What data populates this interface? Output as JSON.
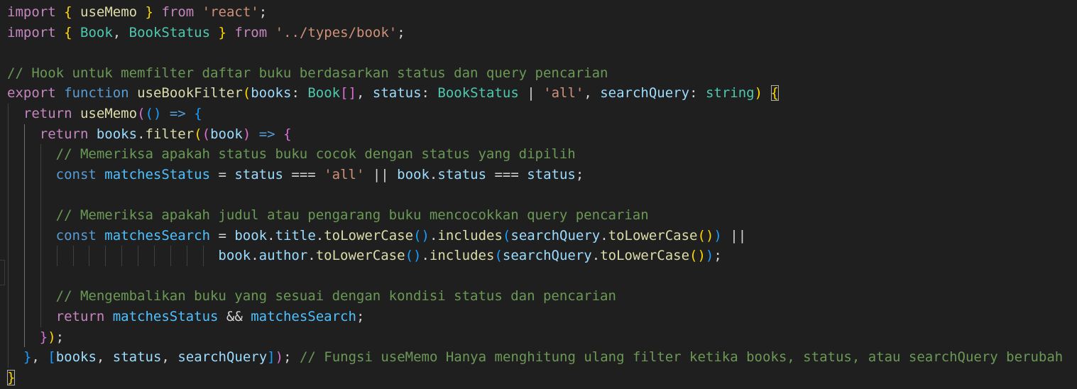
{
  "editor": {
    "language": "typescript",
    "colors": {
      "background": "#1f1f1f",
      "keyword_control": "#c586c0",
      "keyword": "#569cd6",
      "function": "#dcdcaa",
      "variable": "#9cdcfe",
      "type": "#4ec9b0",
      "string": "#ce9178",
      "comment": "#6a9955"
    },
    "lines": [
      [
        [
          "import",
          "kw"
        ],
        [
          " ",
          "op"
        ],
        [
          "{",
          "br1"
        ],
        [
          " ",
          "op"
        ],
        [
          "useMemo",
          "fn"
        ],
        [
          " ",
          "op"
        ],
        [
          "}",
          "br1"
        ],
        [
          " ",
          "op"
        ],
        [
          "from",
          "kw"
        ],
        [
          " ",
          "op"
        ],
        [
          "'react'",
          "str"
        ],
        [
          ";",
          "op"
        ]
      ],
      [
        [
          "import",
          "kw"
        ],
        [
          " ",
          "op"
        ],
        [
          "{",
          "br1"
        ],
        [
          " ",
          "op"
        ],
        [
          "Book",
          "type"
        ],
        [
          ", ",
          "op"
        ],
        [
          "BookStatus",
          "type"
        ],
        [
          " ",
          "op"
        ],
        [
          "}",
          "br1"
        ],
        [
          " ",
          "op"
        ],
        [
          "from",
          "kw"
        ],
        [
          " ",
          "op"
        ],
        [
          "'../types/book'",
          "str"
        ],
        [
          ";",
          "op"
        ]
      ],
      [],
      [
        [
          "// Hook untuk memfilter daftar buku berdasarkan status dan query pencarian",
          "com"
        ]
      ],
      [
        [
          "export",
          "kw"
        ],
        [
          " ",
          "op"
        ],
        [
          "function",
          "kw2"
        ],
        [
          " ",
          "op"
        ],
        [
          "useBookFilter",
          "fn"
        ],
        [
          "(",
          "br1"
        ],
        [
          "books",
          "var"
        ],
        [
          ": ",
          "op"
        ],
        [
          "Book",
          "type"
        ],
        [
          "[]",
          "br2"
        ],
        [
          ", ",
          "op"
        ],
        [
          "status",
          "var"
        ],
        [
          ": ",
          "op"
        ],
        [
          "BookStatus",
          "type"
        ],
        [
          " | ",
          "op"
        ],
        [
          "'all'",
          "str"
        ],
        [
          ", ",
          "op"
        ],
        [
          "searchQuery",
          "var"
        ],
        [
          ": ",
          "op"
        ],
        [
          "string",
          "type"
        ],
        [
          ")",
          "br1"
        ],
        [
          " ",
          "op"
        ],
        [
          "{",
          "br1",
          "match"
        ]
      ],
      [
        [
          "  ",
          "op"
        ],
        [
          "return",
          "kw"
        ],
        [
          " ",
          "op"
        ],
        [
          "useMemo",
          "fn"
        ],
        [
          "(",
          "br2"
        ],
        [
          "()",
          "br3"
        ],
        [
          " ",
          "op"
        ],
        [
          "=>",
          "kw2"
        ],
        [
          " ",
          "op"
        ],
        [
          "{",
          "br3"
        ]
      ],
      [
        [
          "    ",
          "op"
        ],
        [
          "return",
          "kw"
        ],
        [
          " ",
          "op"
        ],
        [
          "books",
          "var"
        ],
        [
          ".",
          "op"
        ],
        [
          "filter",
          "fn"
        ],
        [
          "(",
          "br1"
        ],
        [
          "(",
          "br2"
        ],
        [
          "book",
          "var"
        ],
        [
          ")",
          "br2"
        ],
        [
          " ",
          "op"
        ],
        [
          "=>",
          "kw2"
        ],
        [
          " ",
          "op"
        ],
        [
          "{",
          "br2"
        ]
      ],
      [
        [
          "      ",
          "op"
        ],
        [
          "// Memeriksa apakah status buku cocok dengan status yang dipilih",
          "com"
        ]
      ],
      [
        [
          "      ",
          "op"
        ],
        [
          "const",
          "kw2"
        ],
        [
          " ",
          "op"
        ],
        [
          "matchesStatus",
          "const"
        ],
        [
          " = ",
          "op"
        ],
        [
          "status",
          "var"
        ],
        [
          " === ",
          "op"
        ],
        [
          "'all'",
          "str"
        ],
        [
          " || ",
          "op"
        ],
        [
          "book",
          "var"
        ],
        [
          ".",
          "op"
        ],
        [
          "status",
          "var"
        ],
        [
          " === ",
          "op"
        ],
        [
          "status",
          "var"
        ],
        [
          ";",
          "op"
        ]
      ],
      [],
      [
        [
          "      ",
          "op"
        ],
        [
          "// Memeriksa apakah judul atau pengarang buku mencocokkan query pencarian",
          "com"
        ]
      ],
      [
        [
          "      ",
          "op"
        ],
        [
          "const",
          "kw2"
        ],
        [
          " ",
          "op"
        ],
        [
          "matchesSearch",
          "const"
        ],
        [
          " = ",
          "op"
        ],
        [
          "book",
          "var"
        ],
        [
          ".",
          "op"
        ],
        [
          "title",
          "var"
        ],
        [
          ".",
          "op"
        ],
        [
          "toLowerCase",
          "fn"
        ],
        [
          "()",
          "br3"
        ],
        [
          ".",
          "op"
        ],
        [
          "includes",
          "fn"
        ],
        [
          "(",
          "br3"
        ],
        [
          "searchQuery",
          "var"
        ],
        [
          ".",
          "op"
        ],
        [
          "toLowerCase",
          "fn"
        ],
        [
          "()",
          "br1"
        ],
        [
          ")",
          "br3"
        ],
        [
          " ||",
          "op"
        ]
      ],
      [
        [
          "                          ",
          "op"
        ],
        [
          "book",
          "var"
        ],
        [
          ".",
          "op"
        ],
        [
          "author",
          "var"
        ],
        [
          ".",
          "op"
        ],
        [
          "toLowerCase",
          "fn"
        ],
        [
          "()",
          "br3"
        ],
        [
          ".",
          "op"
        ],
        [
          "includes",
          "fn"
        ],
        [
          "(",
          "br3"
        ],
        [
          "searchQuery",
          "var"
        ],
        [
          ".",
          "op"
        ],
        [
          "toLowerCase",
          "fn"
        ],
        [
          "()",
          "br1"
        ],
        [
          ")",
          "br3"
        ],
        [
          ";",
          "op"
        ]
      ],
      [],
      [
        [
          "      ",
          "op"
        ],
        [
          "// Mengembalikan buku yang sesuai dengan kondisi status dan pencarian",
          "com"
        ]
      ],
      [
        [
          "      ",
          "op"
        ],
        [
          "return",
          "kw"
        ],
        [
          " ",
          "op"
        ],
        [
          "matchesStatus",
          "const"
        ],
        [
          " && ",
          "op"
        ],
        [
          "matchesSearch",
          "const"
        ],
        [
          ";",
          "op"
        ]
      ],
      [
        [
          "    ",
          "op"
        ],
        [
          "}",
          "br2"
        ],
        [
          ")",
          "br1"
        ],
        [
          ";",
          "op"
        ]
      ],
      [
        [
          "  ",
          "op"
        ],
        [
          "}",
          "br3"
        ],
        [
          ", ",
          "op"
        ],
        [
          "[",
          "br3"
        ],
        [
          "books",
          "var"
        ],
        [
          ", ",
          "op"
        ],
        [
          "status",
          "var"
        ],
        [
          ", ",
          "op"
        ],
        [
          "searchQuery",
          "var"
        ],
        [
          "]",
          "br3"
        ],
        [
          ")",
          "br2"
        ],
        [
          ";",
          "op"
        ],
        [
          " ",
          "op"
        ],
        [
          "// Fungsi useMemo Hanya menghitung ulang filter ketika books, status, atau searchQuery berubah",
          "com"
        ]
      ],
      [
        [
          "}",
          "br1",
          "match"
        ]
      ]
    ]
  }
}
